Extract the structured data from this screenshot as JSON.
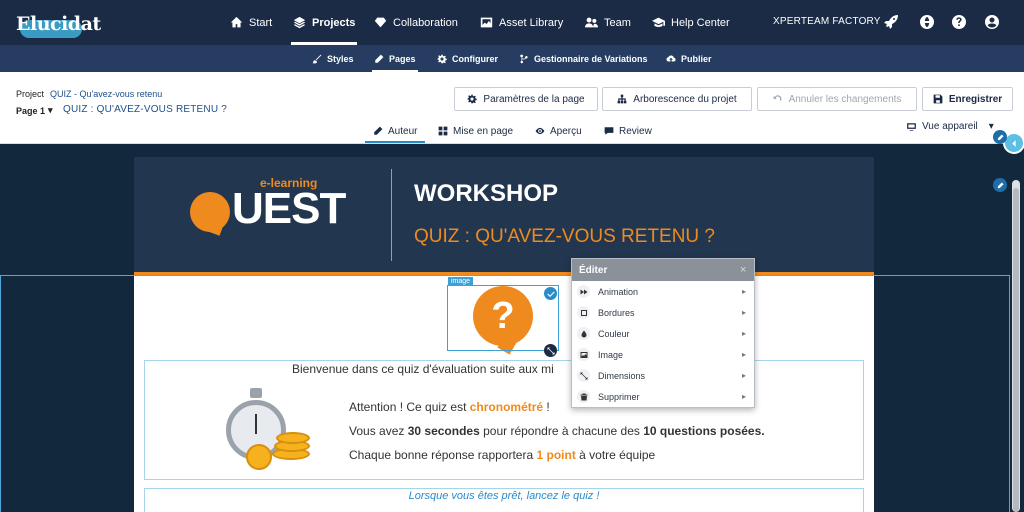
{
  "app": {
    "logo": "Elucidat",
    "org": "XPERTEAM FACTORY"
  },
  "topnav": {
    "items": [
      {
        "label": "Start",
        "icon": "home-icon"
      },
      {
        "label": "Projects",
        "icon": "layers-icon",
        "active": true
      },
      {
        "label": "Collaboration",
        "icon": "diamond-icon"
      },
      {
        "label": "Asset Library",
        "icon": "image-icon"
      },
      {
        "label": "Team",
        "icon": "team-icon"
      },
      {
        "label": "Help Center",
        "icon": "graduation-icon"
      }
    ],
    "right_icons": [
      "rocket-icon",
      "globe-icon",
      "help-icon",
      "user-icon"
    ]
  },
  "subnav": {
    "items": [
      {
        "label": "Styles",
        "icon": "brush-icon"
      },
      {
        "label": "Pages",
        "icon": "pencil-icon",
        "active": true
      },
      {
        "label": "Configurer",
        "icon": "gear-icon"
      },
      {
        "label": "Gestionnaire de Variations",
        "icon": "branch-icon"
      },
      {
        "label": "Publier",
        "icon": "cloud-upload-icon"
      }
    ]
  },
  "toolbar": {
    "project_label": "Project",
    "project_name": "QUIZ - Qu'avez-vous retenu",
    "page_select": "Page 1",
    "page_title": "QUIZ : QU'AVEZ-VOUS RETENU ?",
    "buttons": {
      "page_settings": "Paramètres de la page",
      "tree": "Arborescence du projet",
      "undo": "Annuler les changements",
      "save": "Enregistrer"
    },
    "modes": [
      {
        "label": "Auteur",
        "icon": "pencil-icon",
        "active": true
      },
      {
        "label": "Mise en page",
        "icon": "grid-icon"
      },
      {
        "label": "Aperçu",
        "icon": "eye-icon"
      },
      {
        "label": "Review",
        "icon": "comment-icon"
      }
    ],
    "device_view": "Vue appareil"
  },
  "page": {
    "logo_tagline": "e-learning",
    "logo_text": "UEST",
    "workshop_title": "WORKSHOP",
    "workshop_subtitle": "QUIZ : QU'AVEZ-VOUS RETENU ?",
    "image_tag": "image",
    "question_mark": "?",
    "welcome": "Bienvenue dans ce quiz d'évaluation suite aux mi",
    "line1_a": "Attention ! Ce quiz est ",
    "line1_b": "chronométré",
    "line1_c": " !",
    "line2_a": "Vous avez ",
    "line2_b": "30 secondes",
    "line2_c": " pour répondre à chacune des ",
    "line2_d": "10 questions posées.",
    "line3_a": "Chaque bonne réponse rapportera ",
    "line3_b": "1 point",
    "line3_c": " à votre équipe",
    "cta": "Lorsque vous êtes prêt, lancez le quiz !"
  },
  "context_menu": {
    "title": "Éditer",
    "close": "×",
    "items": [
      {
        "label": "Animation",
        "icon": "fast-forward-icon"
      },
      {
        "label": "Bordures",
        "icon": "border-icon"
      },
      {
        "label": "Couleur",
        "icon": "drop-icon"
      },
      {
        "label": "Image",
        "icon": "image-icon"
      },
      {
        "label": "Dimensions",
        "icon": "resize-icon"
      },
      {
        "label": "Supprimer",
        "icon": "trash-icon"
      }
    ]
  },
  "colors": {
    "nav": "#1b2a45",
    "subnav": "#263c60",
    "accent": "#ef8a1e",
    "link": "#2a8bc9"
  }
}
